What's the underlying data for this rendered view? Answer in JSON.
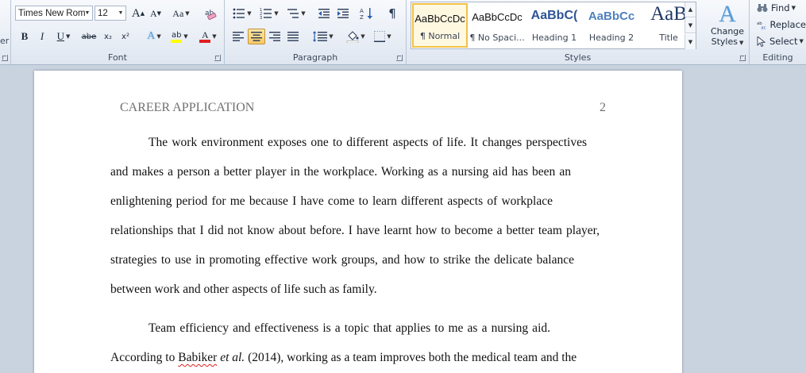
{
  "ribbon": {
    "clipboard_fragment": "er",
    "font": {
      "name": "Times New Rom",
      "size": "12",
      "label": "Font",
      "grow_glyph": "A",
      "shrink_glyph": "A",
      "case_glyph": "Aa",
      "bold": "B",
      "italic": "I",
      "underline": "U",
      "strike": "abe",
      "subscript": "x₂",
      "superscript": "x²",
      "text_effects": "A",
      "highlight": "ab",
      "font_color": "A",
      "font_color_hex": "#e02020",
      "highlight_hex": "#ffff00"
    },
    "paragraph": {
      "label": "Paragraph",
      "pilcrow": "¶"
    },
    "styles": {
      "label": "Styles",
      "items": [
        {
          "sample": "AaBbCcDc",
          "name": "¶ Normal",
          "selected": true
        },
        {
          "sample": "AaBbCcDc",
          "name": "¶ No Spaci...",
          "selected": false
        },
        {
          "sample": "AaBbC(",
          "name": "Heading 1",
          "selected": false
        },
        {
          "sample": "AaBbCc",
          "name": "Heading 2",
          "selected": false
        },
        {
          "sample": "AaB",
          "name": "Title",
          "selected": false
        }
      ],
      "change_styles_line1": "Change",
      "change_styles_line2": "Styles",
      "change_styles_glyph": "A"
    },
    "editing": {
      "label": "Editing",
      "find": "Find",
      "replace": "Replace",
      "select": "Select"
    }
  },
  "document": {
    "header": "CAREER APPLICATION",
    "page_number": "2",
    "lines": [
      "The work environment exposes one to different aspects of life. It changes perspectives",
      "and makes a person a better player in the workplace. Working as a nursing aid has been an",
      "enlightening period for me because I have come to learn different aspects of workplace",
      "relationships that I did not know about before. I have learnt how to become a better team player,",
      "strategies to use in promoting effective work groups, and how to strike the delicate balance",
      "between work and other aspects of life such as family.",
      "Team efficiency and effectiveness is a topic that applies to me as a nursing aid."
    ],
    "last_line": {
      "before": "According to ",
      "name": "Babiker",
      "etal": "et al.",
      "after": " (2014), working as a team improves both the medical team and the"
    }
  }
}
